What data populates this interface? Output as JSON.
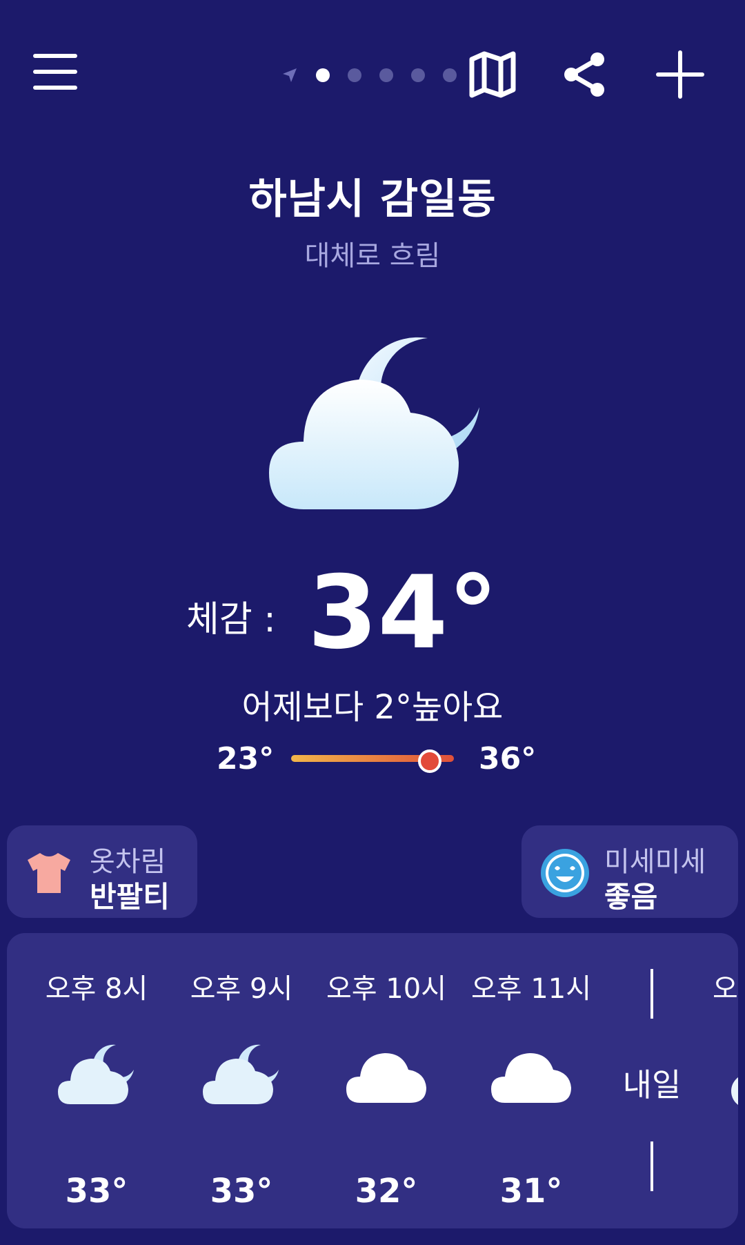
{
  "header": {
    "location": "하남시 감일동",
    "condition": "대체로 흐림",
    "page_count": 5,
    "active_page": 0
  },
  "current": {
    "feels_label": "체감 :",
    "feels_value": "34°",
    "comparison": "어제보다 2°높아요",
    "temp_min": "23°",
    "temp_max": "36°",
    "current_position_pct": 85,
    "icon": "cloud-moon-icon"
  },
  "chips": {
    "clothing": {
      "label": "옷차림",
      "value": "반팔티",
      "icon": "tshirt-icon"
    },
    "fine_dust": {
      "label": "미세미세",
      "value": "좋음",
      "icon": "happy-face-icon"
    }
  },
  "hourly": [
    {
      "time": "오후 8시",
      "icon": "cloud-moon-icon",
      "temp": "33°"
    },
    {
      "time": "오후 9시",
      "icon": "cloud-moon-icon",
      "temp": "33°"
    },
    {
      "time": "오후 10시",
      "icon": "cloud-icon",
      "temp": "32°"
    },
    {
      "time": "오후 11시",
      "icon": "cloud-icon",
      "temp": "31°"
    }
  ],
  "hourly_divider_label": "내일",
  "hourly_next_time_partial": "오",
  "colors": {
    "background": "#1c1a6b",
    "card": "#322f83",
    "range_start": "#f2b64a",
    "range_end": "#e0503a"
  }
}
